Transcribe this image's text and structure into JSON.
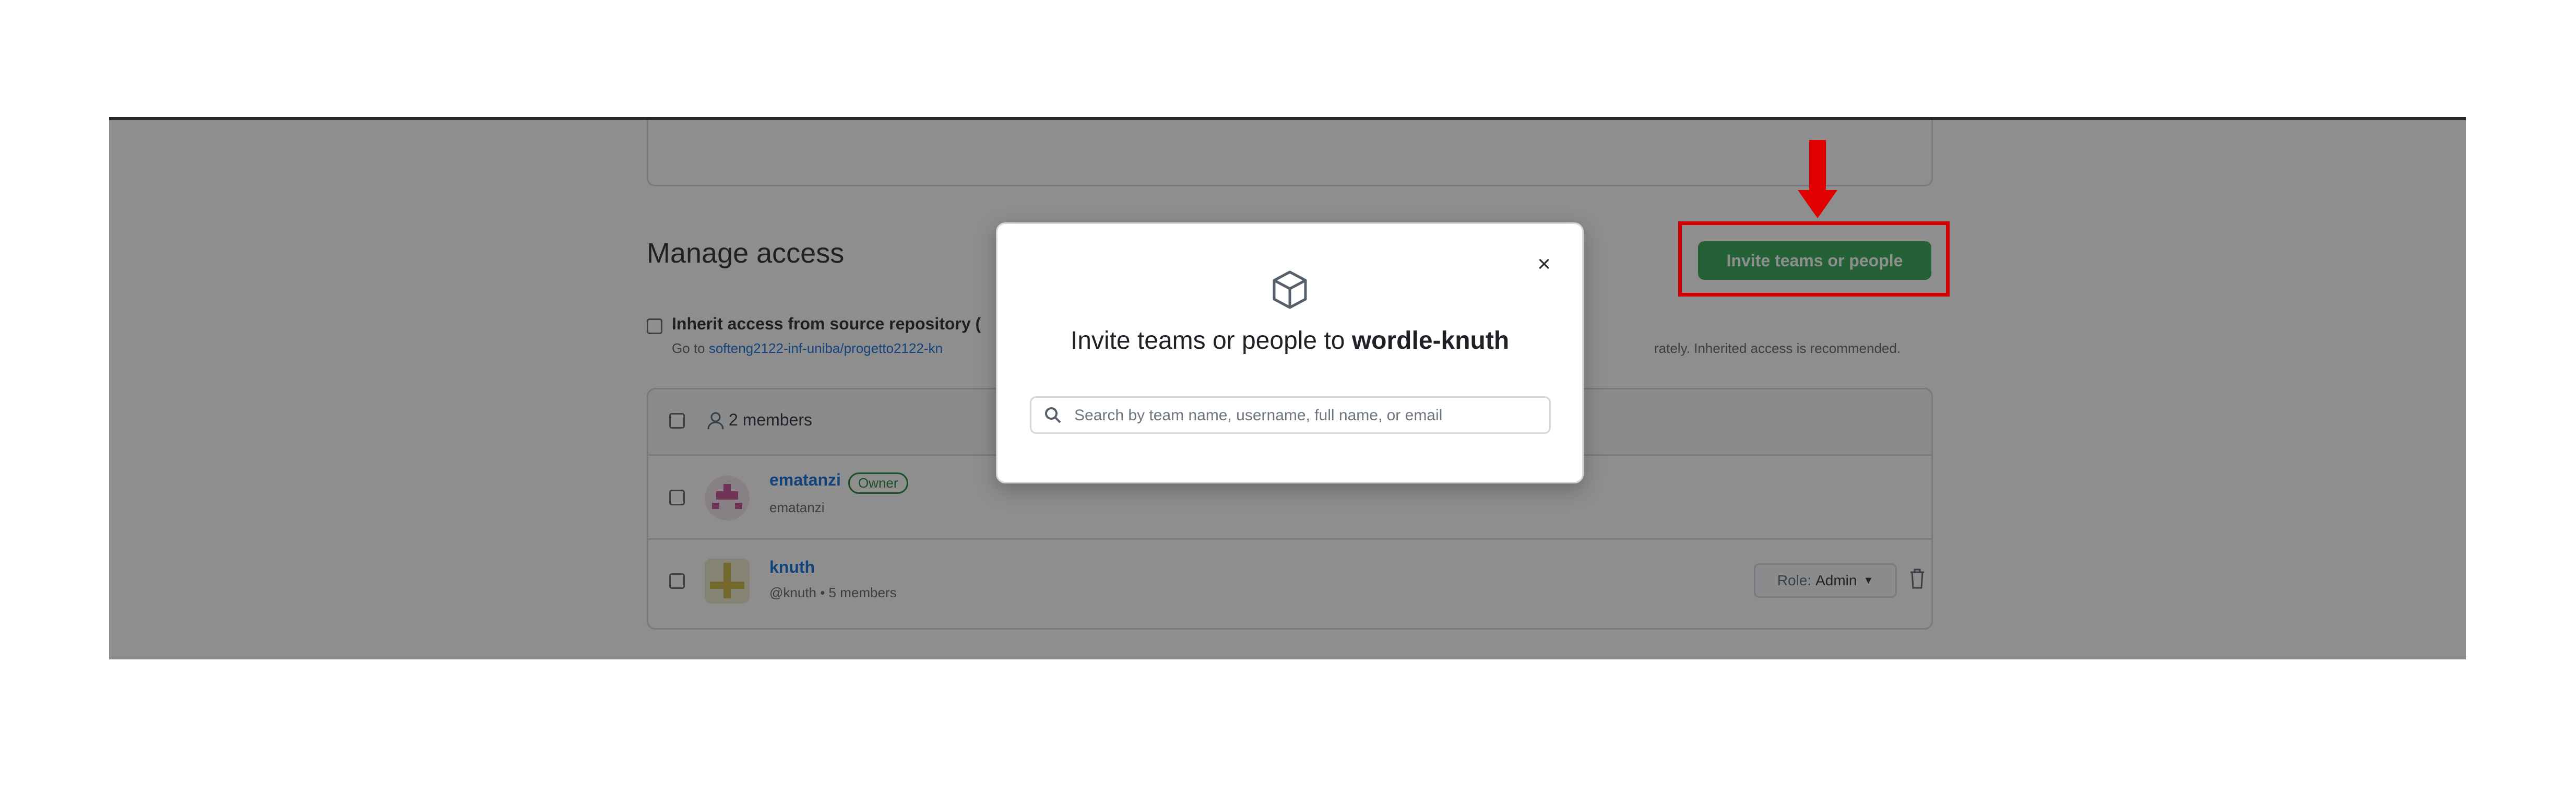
{
  "manage_access": {
    "heading": "Manage access",
    "invite_button": "Invite teams or people",
    "inherit_label": "Inherit access from source repository (",
    "goto_prefix": "Go to ",
    "goto_link": "softeng2122-inf-uniba/progetto2122-kn",
    "recommend_text": "rately. Inherited access is recommended."
  },
  "members_table": {
    "header": "2 members",
    "rows": [
      {
        "name": "ematanzi",
        "badge": "Owner",
        "sub": "ematanzi"
      },
      {
        "name": "knuth",
        "sub": "@knuth • 5 members",
        "role_prefix": "Role:",
        "role_value": "Admin"
      }
    ]
  },
  "modal": {
    "title_prefix": "Invite teams or people to ",
    "repo": "wordle-knuth",
    "close": "×",
    "search_placeholder": "Search by team name, username, full name, or email"
  },
  "colors": {
    "accent_green": "#2da44e",
    "annotation_red": "#d40000",
    "link_blue": "#0969da"
  }
}
